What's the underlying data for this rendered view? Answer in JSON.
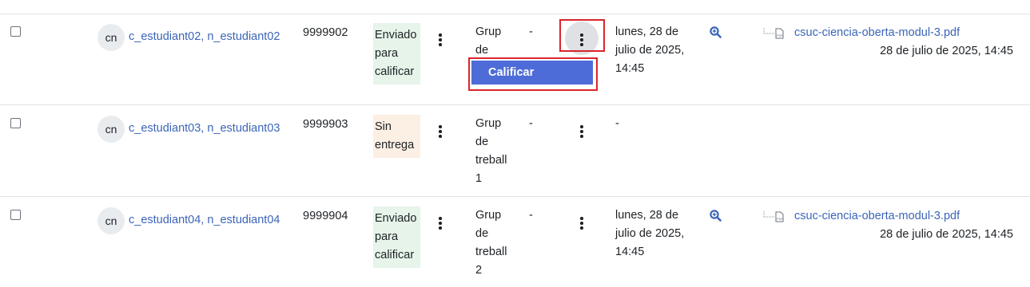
{
  "rows": [
    {
      "avatar": "cn",
      "name": "c_estudiant02, n_estudiant02",
      "id": "9999902",
      "status": [
        "Enviado",
        "para",
        "calificar"
      ],
      "group": [
        "Grup",
        "de"
      ],
      "grade": "-",
      "date": [
        "lunes, 28 de",
        "julio de 2025,",
        "14:45"
      ],
      "file": "csuc-ciencia-oberta-modul-3.pdf",
      "file_date": "28 de julio de 2025, 14:45"
    },
    {
      "avatar": "cn",
      "name": "c_estudiant03, n_estudiant03",
      "id": "9999903",
      "status": [
        "Sin",
        "entrega"
      ],
      "group": [
        "Grup",
        "de",
        "treball",
        "1"
      ],
      "grade": "-",
      "date": [
        "-"
      ]
    },
    {
      "avatar": "cn",
      "name": "c_estudiant04, n_estudiant04",
      "id": "9999904",
      "status": [
        "Enviado",
        "para",
        "calificar"
      ],
      "group": [
        "Grup",
        "de",
        "treball",
        "2"
      ],
      "grade": "-",
      "date": [
        "lunes, 28 de",
        "julio de 2025,",
        "14:45"
      ],
      "file": "csuc-ciencia-oberta-modul-3.pdf",
      "file_date": "28 de julio de 2025, 14:45"
    }
  ],
  "dropdown": {
    "grade_label": "Calificar"
  },
  "colors": {
    "link": "#3b65b8",
    "accent": "#4e6cd8",
    "highlight": "#d9252b",
    "submitted_bg": "#e6f4ea",
    "nosub_bg": "#fcefe3"
  }
}
